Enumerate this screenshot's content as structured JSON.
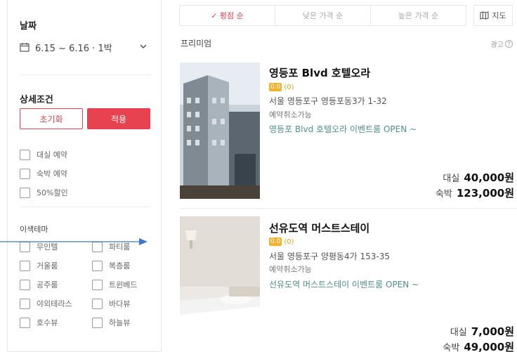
{
  "sidebar": {
    "date_title": "날짜",
    "date_value": "6.15 ~ 6.16 · 1박",
    "detail_title": "상세조건",
    "reset_label": "초기화",
    "apply_label": "적용",
    "stay_options": [
      {
        "label": "대실 예약",
        "checked": false
      },
      {
        "label": "숙박 예약",
        "checked": false
      },
      {
        "label": "50%할인",
        "checked": false
      }
    ],
    "theme_title": "이색테마",
    "themes_left": [
      "무인텔",
      "거울룸",
      "공주룸",
      "야외테라스",
      "호수뷰"
    ],
    "themes_right": [
      "파티룸",
      "복층룸",
      "트윈베드",
      "바다뷰",
      "하늘뷰"
    ]
  },
  "sort": {
    "tabs": [
      "✓ 평점 순",
      "낮은 가격 순",
      "높은 가격 순"
    ],
    "active_index": 0,
    "map_label": "지도"
  },
  "section": {
    "premium_label": "프리미엄",
    "ad_label": "광고",
    "ad_help": "?"
  },
  "listings": [
    {
      "name": "영등포 Blvd 호텔오라",
      "score": "0.0",
      "reviews": "(0)",
      "address": "서울 영등포구 영등포동3가 1-32",
      "cancel": "예약취소가능",
      "event": "영등포 Blvd 호텔오라 이벤트룸 OPEN ~",
      "day_label": "대실",
      "day_price": "40,000원",
      "night_label": "숙박",
      "night_price": "123,000원"
    },
    {
      "name": "선유도역 머스트스테이",
      "score": "0.0",
      "reviews": "(0)",
      "address": "서울 영등포구 양평동4가 153-35",
      "cancel": "예약취소가능",
      "event": "선유도역 머스트스테이 이벤트룸 OPEN ~",
      "day_label": "대실",
      "day_price": "7,000원",
      "night_label": "숙박",
      "night_price": "49,000원"
    }
  ],
  "colors": {
    "accent": "#e6424f",
    "event_text": "#4f8f88",
    "arrow": "#3b78c9",
    "rating_badge": "#f2b12e"
  }
}
